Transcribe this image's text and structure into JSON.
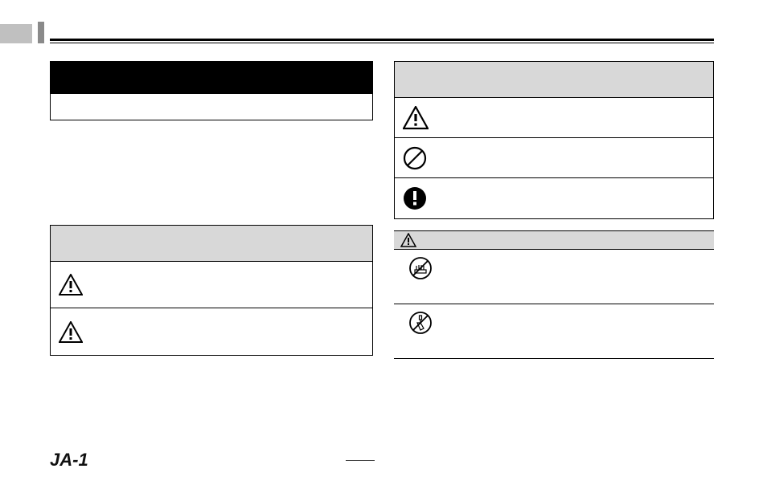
{
  "page_number": "JA-1",
  "icons": {
    "warning": "warning-triangle",
    "prohibit": "prohibit-circle",
    "mandatory": "mandatory-circle",
    "small_warning": "warning-triangle-small",
    "no_wet_hand": "no-wet-hand",
    "no_disassemble": "no-disassemble"
  }
}
